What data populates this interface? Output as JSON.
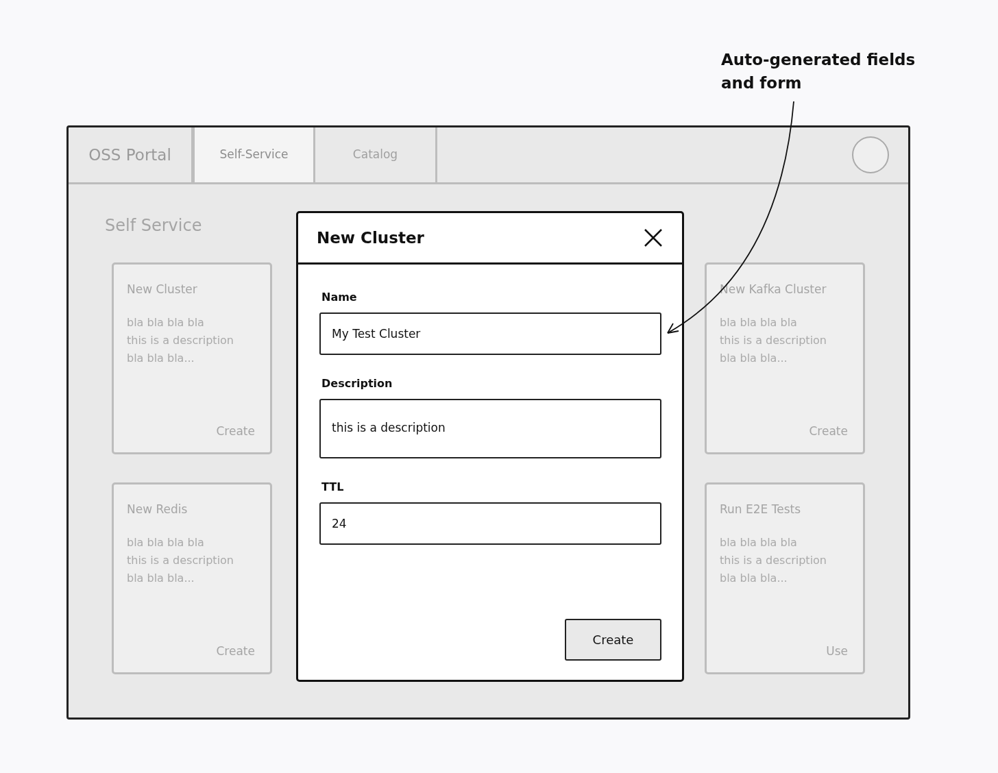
{
  "annotation": {
    "text": "Auto-generated fields\nand form"
  },
  "nav": {
    "brand": "OSS Portal",
    "tabs": [
      {
        "label": "Self-Service",
        "selected": true
      },
      {
        "label": "Catalog",
        "selected": false
      }
    ]
  },
  "page_title": "Self Service",
  "cards": [
    {
      "title": "New Cluster",
      "description": "bla bla bla bla\nthis is a description\nbla bla bla...",
      "action": "Create"
    },
    {
      "title": "New Redis",
      "description": "bla bla bla bla\nthis is a description\nbla bla bla...",
      "action": "Create"
    },
    {
      "title": "New Kafka Cluster",
      "description": "bla bla bla bla\nthis is a description\nbla bla bla...",
      "action": "Create"
    },
    {
      "title": "Run E2E Tests",
      "description": "bla bla bla bla\nthis is a description\nbla bla bla...",
      "action": "Use"
    }
  ],
  "modal": {
    "title": "New Cluster",
    "fields": [
      {
        "kind": "text",
        "label": "Name",
        "value": "My Test Cluster"
      },
      {
        "kind": "textarea",
        "label": "Description",
        "value": "this is a description"
      },
      {
        "kind": "text",
        "label": "TTL",
        "value": "24"
      }
    ],
    "submit": "Create"
  }
}
